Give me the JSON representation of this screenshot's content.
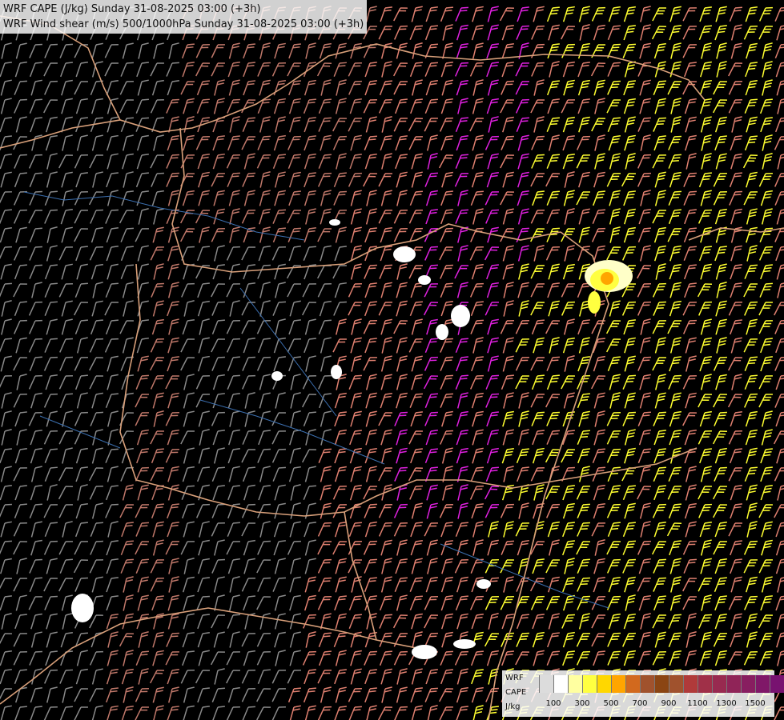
{
  "title": {
    "line1": "WRF CAPE (J/kg) Sunday 31-08-2025 03:00 (+3h)",
    "line2": "WRF Wind shear (m/s) 500/1000hPa Sunday 31-08-2025 03:00 (+3h)"
  },
  "legend": {
    "label_line1": "WRF",
    "label_line2": "CAPE",
    "label_line3": "J/kg",
    "colors": [
      "#dcdcdc",
      "#ffffff",
      "#ffffa0",
      "#ffff40",
      "#ffd700",
      "#ffa500",
      "#d2691e",
      "#a0522d",
      "#8b4513",
      "#a0522d",
      "#b03a3a",
      "#a03048",
      "#982a50",
      "#902458",
      "#881e60",
      "#801868",
      "#781270"
    ],
    "ticks": [
      "100",
      "300",
      "500",
      "700",
      "900",
      "1100",
      "1300",
      "1500"
    ]
  },
  "colors": {
    "background": "#000000",
    "border": "#d9a07a",
    "river": "#3b6fb0",
    "shear_low": "#8a8a8a",
    "shear_mid": "#c0786a",
    "shear_high": "#e08070",
    "shear_magenta": "#e020e0",
    "shear_yellow": "#ffff30"
  }
}
